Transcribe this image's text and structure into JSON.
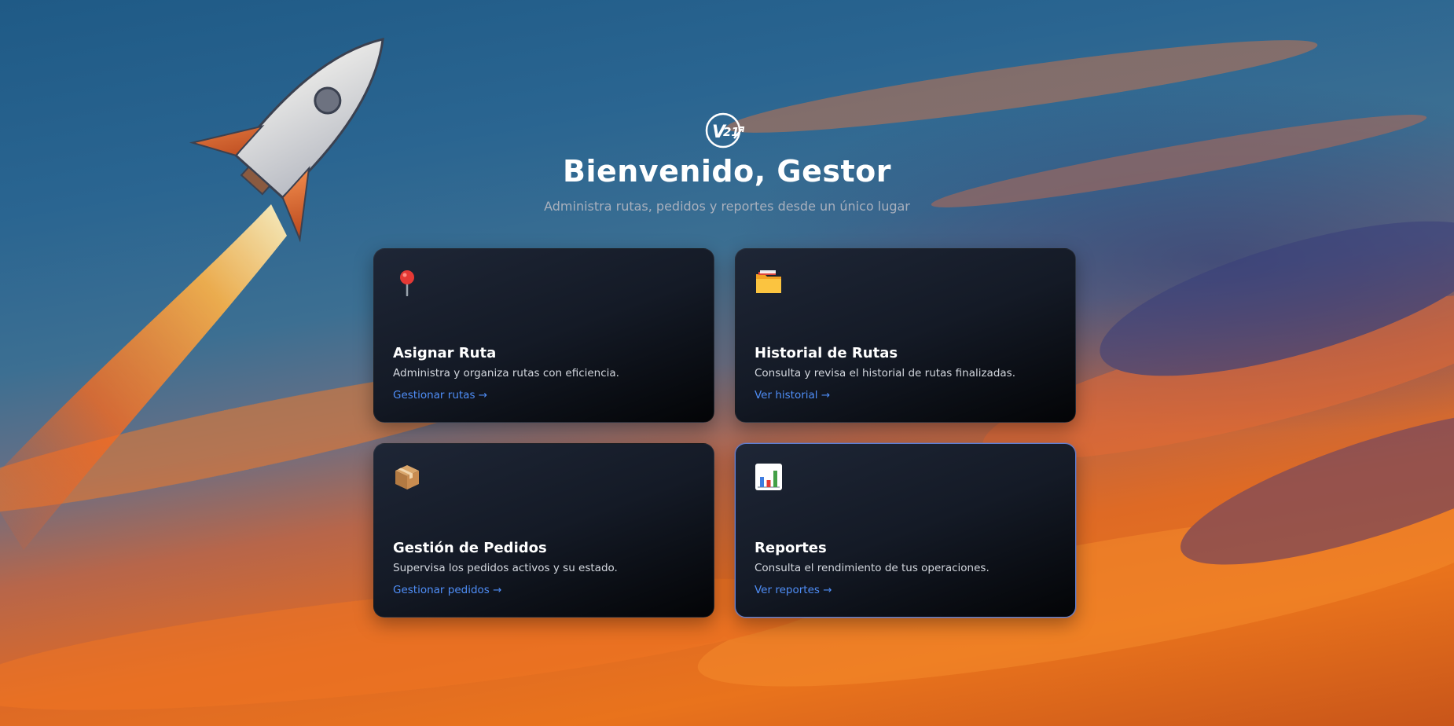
{
  "header": {
    "logo": "v21-logo",
    "title": "Bienvenido, Gestor",
    "subtitle": "Administra rutas, pedidos y reportes desde un único lugar"
  },
  "cards": [
    {
      "icon": "pin-icon",
      "title": "Asignar Ruta",
      "description": "Administra y organiza rutas con eficiencia.",
      "link": "Gestionar rutas →"
    },
    {
      "icon": "folder-icon",
      "title": "Historial de Rutas",
      "description": "Consulta y revisa el historial de rutas finalizadas.",
      "link": "Ver historial →"
    },
    {
      "icon": "package-icon",
      "title": "Gestión de Pedidos",
      "description": "Supervisa los pedidos activos y su estado.",
      "link": "Gestionar pedidos →"
    },
    {
      "icon": "bar-chart-icon",
      "title": "Reportes",
      "description": "Consulta el rendimiento de tus operaciones.",
      "link": "Ver reportes →"
    }
  ],
  "colors": {
    "accent_link": "#4f8ef7",
    "hover_border": "#5d7fd6"
  }
}
